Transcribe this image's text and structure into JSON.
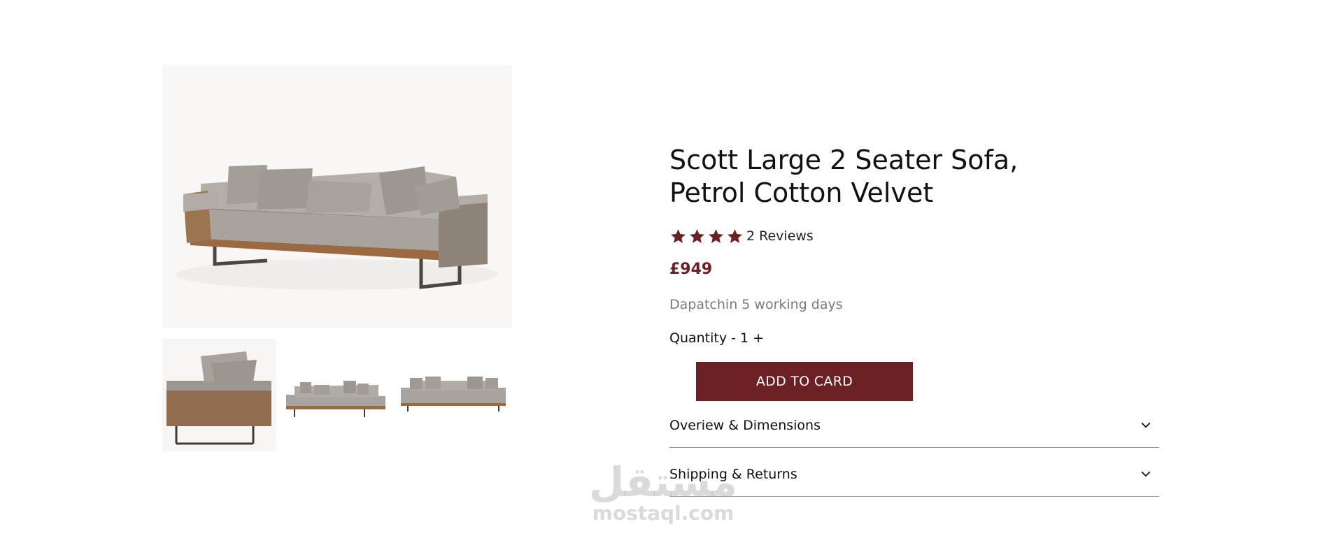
{
  "product": {
    "title_line1": "Scott Large 2 Seater Sofa,",
    "title_line2": "Petrol Cotton Velvet",
    "rating_stars": 4,
    "reviews_label": "2 Reviews",
    "price": "£949",
    "dispatch": "Dapatchin 5 working days",
    "quantity_label": "Quantity",
    "quantity_minus": "-",
    "quantity_value": "1",
    "quantity_plus": "+",
    "add_button_label": "ADD TO CARD"
  },
  "accordion": [
    {
      "label": "Overiew & Dimensions",
      "icon": "chevron-down-icon"
    },
    {
      "label": "Shipping & Returns",
      "icon": "chevron-down-icon"
    }
  ],
  "gallery": {
    "main_image": "sofa-front-angle-image",
    "thumbnails": [
      "sofa-side-thumbnail",
      "sofa-angle-thumbnail",
      "sofa-front-thumbnail"
    ]
  },
  "watermark": {
    "logo": "مستقل",
    "url": "mostaql.com"
  },
  "colors": {
    "accent": "#6b2024",
    "text": "#111111",
    "muted": "#7a7a7a",
    "divider": "#8a8a8a"
  }
}
